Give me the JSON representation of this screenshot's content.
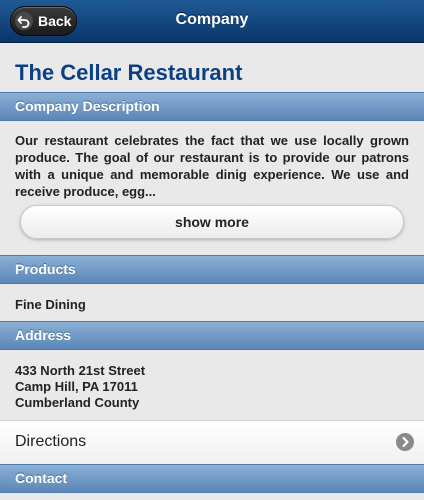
{
  "header": {
    "title": "Company",
    "back_label": "Back"
  },
  "company": {
    "name": "The Cellar Restaurant"
  },
  "sections": {
    "description": {
      "title": "Company Description",
      "text": "Our restaurant celebrates the fact that we use locally grown produce. The goal of our restaurant is to provide our patrons with a unique and memorable dinig experience. We use and receive produce, egg...",
      "show_more_label": "show more"
    },
    "products": {
      "title": "Products",
      "items": [
        "Fine Dining"
      ]
    },
    "address": {
      "title": "Address",
      "lines": [
        "433 North 21st Street",
        "Camp Hill, PA 17011",
        "Cumberland County"
      ],
      "directions_label": "Directions"
    },
    "contact": {
      "title": "Contact"
    }
  }
}
